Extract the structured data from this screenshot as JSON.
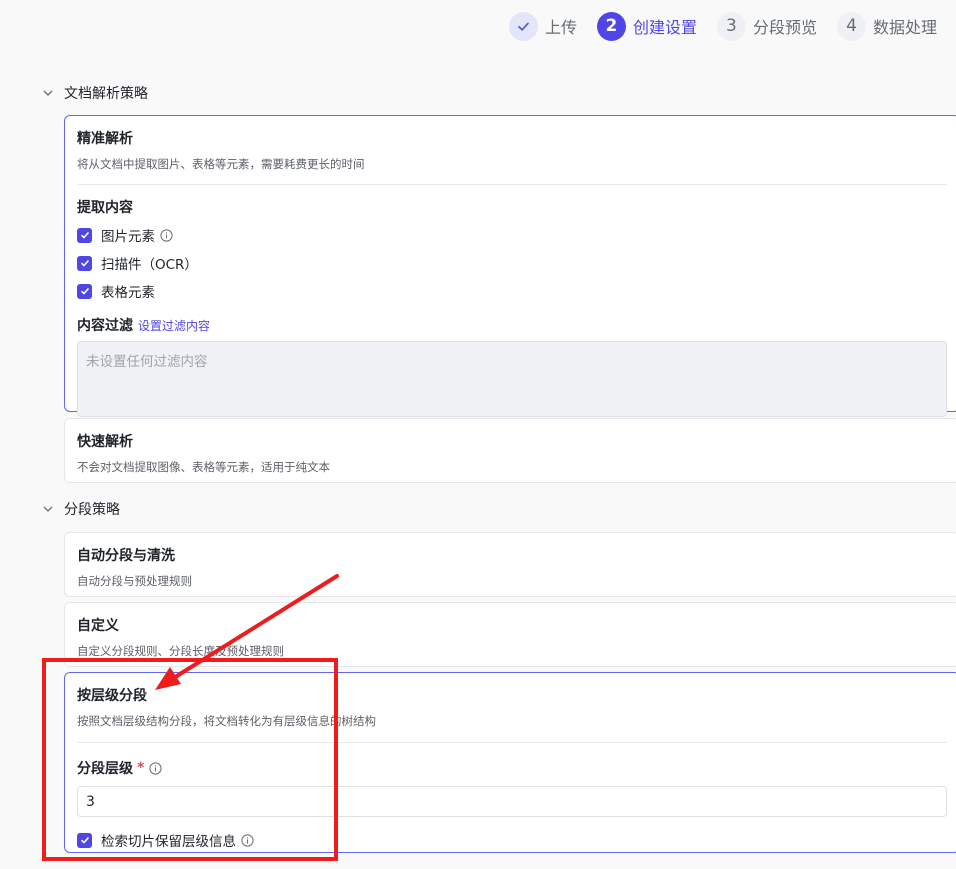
{
  "stepper": [
    {
      "num": "",
      "label": "上传",
      "state": "done"
    },
    {
      "num": "2",
      "label": "创建设置",
      "state": "active"
    },
    {
      "num": "3",
      "label": "分段预览",
      "state": "todo"
    },
    {
      "num": "4",
      "label": "数据处理",
      "state": "todo"
    }
  ],
  "parse_section": {
    "title": "文档解析策略",
    "precise": {
      "title": "精准解析",
      "desc": "将从文档中提取图片、表格等元素，需要耗费更长的时间",
      "extract_label": "提取内容",
      "options": [
        {
          "label": "图片元素",
          "checked": true,
          "info": true
        },
        {
          "label": "扫描件（OCR）",
          "checked": true,
          "info": false
        },
        {
          "label": "表格元素",
          "checked": true,
          "info": false
        }
      ],
      "filter_label": "内容过滤",
      "filter_link": "设置过滤内容",
      "filter_placeholder": "未设置任何过滤内容"
    },
    "fast": {
      "title": "快速解析",
      "desc": "不会对文档提取图像、表格等元素，适用于纯文本"
    }
  },
  "segment_section": {
    "title": "分段策略",
    "auto": {
      "title": "自动分段与清洗",
      "desc": "自动分段与预处理规则"
    },
    "custom": {
      "title": "自定义",
      "desc": "自定义分段规则、分段长度及预处理规则"
    },
    "hierarchy": {
      "title": "按层级分段",
      "desc": "按照文档层级结构分段，将文档转化为有层级信息的树结构",
      "level_label": "分段层级",
      "required_mark": "*",
      "level_value": "3",
      "keep_label": "检索切片保留层级信息",
      "keep_checked": true
    }
  },
  "colors": {
    "accent": "#4f46e5",
    "annotation": "#ee1c1c"
  }
}
